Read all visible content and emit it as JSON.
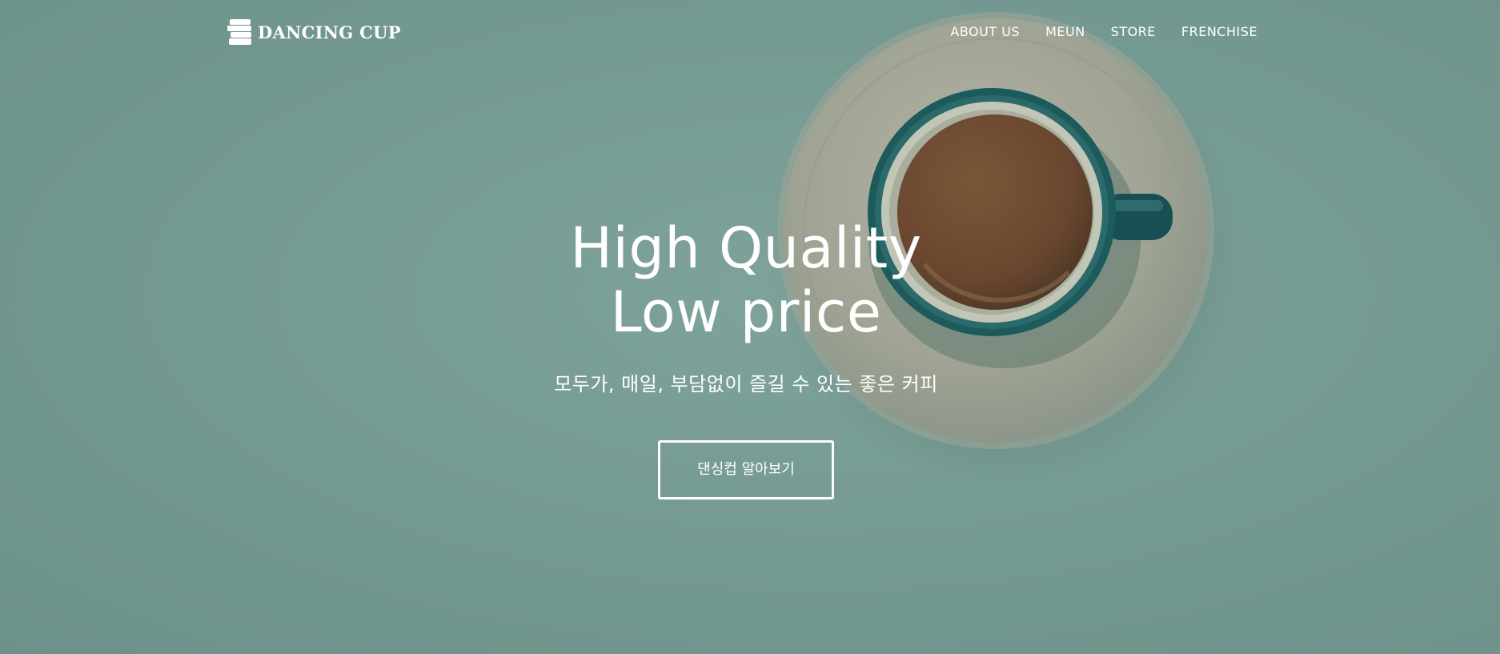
{
  "brand": {
    "name": "DANCING CUP",
    "logo_icon": "stacked-cups-icon"
  },
  "nav": {
    "items": [
      {
        "label": "ABOUT US"
      },
      {
        "label": "MEUN"
      },
      {
        "label": "STORE"
      },
      {
        "label": "FRENCHISE"
      }
    ]
  },
  "hero": {
    "headline_line1": "High Quality",
    "headline_line2": "Low price",
    "subtitle": "모두가, 매일, 부담없이 즐길 수 있는 좋은 커피",
    "cta_label": "댄싱컵 알아보기",
    "illustration": "coffee-cup-image"
  },
  "colors": {
    "background": "#789d95",
    "text": "#ffffff",
    "cup": "#1f5b5c",
    "coffee": "#6e4b32",
    "saucer": "#a9ab9c"
  }
}
